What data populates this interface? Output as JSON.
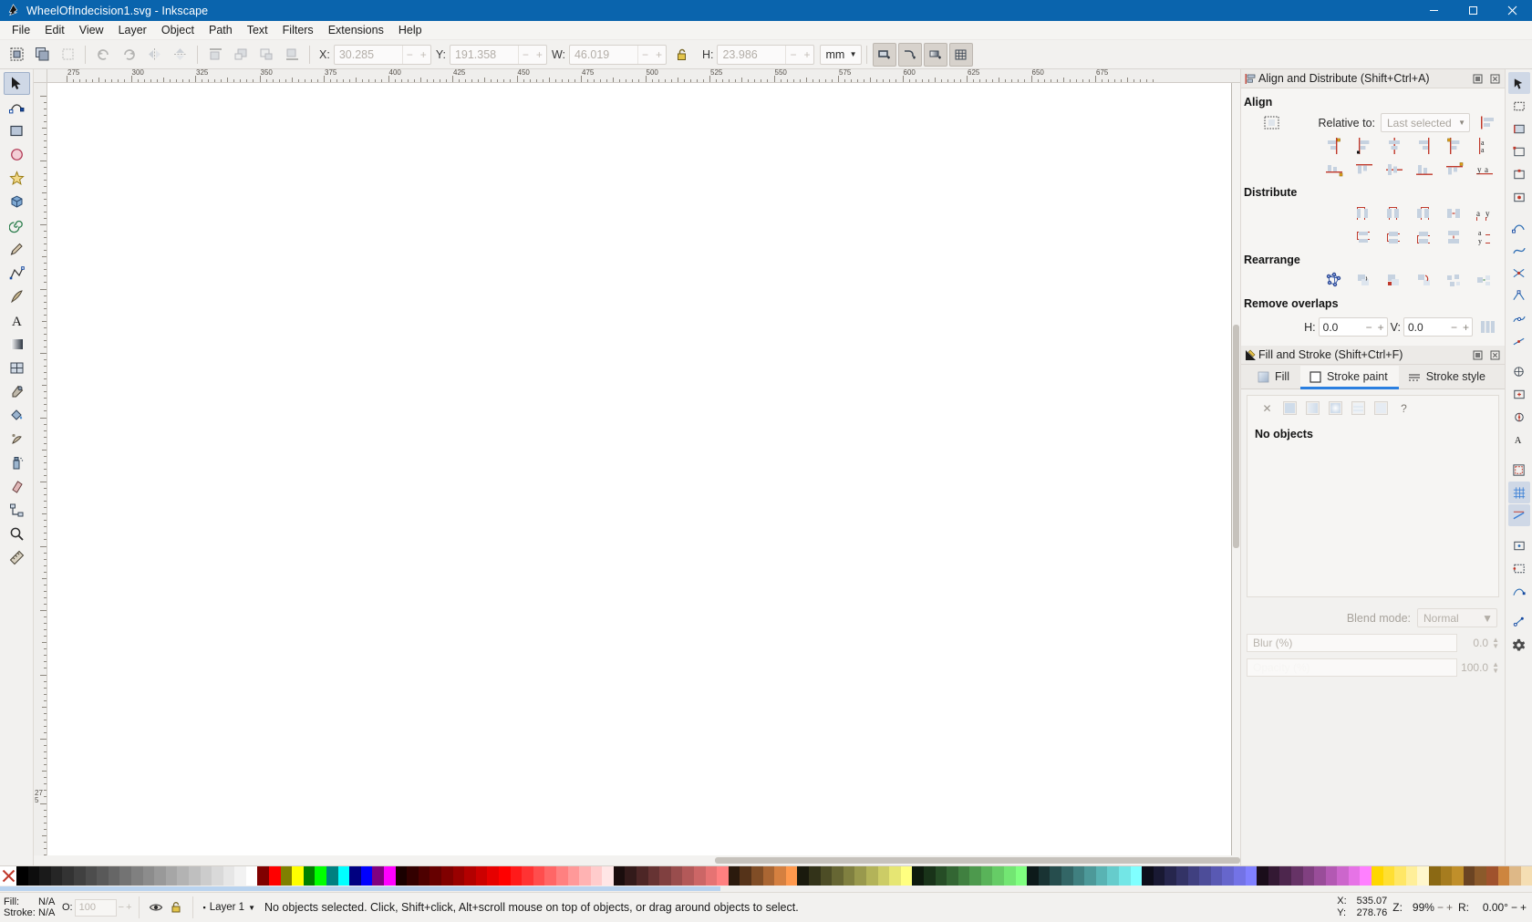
{
  "window": {
    "title": "WheelOfIndecision1.svg - Inkscape",
    "app_icon": "inkscape-logo-icon",
    "minimize": "minimize-button",
    "maximize": "maximize-button",
    "close": "close-button",
    "titlebar_color": "#0a64ad"
  },
  "menu": {
    "items": [
      "File",
      "Edit",
      "View",
      "Layer",
      "Object",
      "Path",
      "Text",
      "Filters",
      "Extensions",
      "Help"
    ]
  },
  "toolcontrols": {
    "select_all_label": "select-all-icon",
    "select_all_in_layers_label": "select-all-in-layers-icon",
    "deselect_label": "deselect-icon",
    "rotate_ccw_label": "rotate-ccw-icon",
    "rotate_cw_label": "rotate-cw-icon",
    "flip_h_label": "flip-horizontal-icon",
    "flip_v_label": "flip-vertical-icon",
    "raise_to_top_label": "raise-to-top-icon",
    "raise_label": "raise-icon",
    "lower_label": "lower-icon",
    "lower_to_bottom_label": "lower-to-bottom-icon",
    "x_label": "X:",
    "x_value": "30.285",
    "y_label": "Y:",
    "y_value": "191.358",
    "w_label": "W:",
    "w_value": "46.019",
    "lock_label": "lock-ratio-icon",
    "h_label": "H:",
    "h_value": "23.986",
    "units": "mm",
    "affect_stroke": "affect-stroke-width-icon",
    "affect_corners": "affect-rounded-corners-icon",
    "affect_gradients": "affect-gradients-icon",
    "affect_patterns": "affect-patterns-icon"
  },
  "toolbox": {
    "tools": [
      {
        "name": "selector-tool",
        "icon": "arrow-pointer",
        "active": true
      },
      {
        "name": "node-tool",
        "icon": "node-editor"
      },
      {
        "name": "rectangle-tool",
        "icon": "square"
      },
      {
        "name": "ellipse-tool",
        "icon": "circle"
      },
      {
        "name": "star-tool",
        "icon": "star"
      },
      {
        "name": "3dbox-tool",
        "icon": "cube"
      },
      {
        "name": "spiral-tool",
        "icon": "spiral"
      },
      {
        "name": "pencil-tool",
        "icon": "pencil"
      },
      {
        "name": "bezier-tool",
        "icon": "pen"
      },
      {
        "name": "calligraphy-tool",
        "icon": "calligraphy-pen"
      },
      {
        "name": "text-tool",
        "icon": "letter-a"
      },
      {
        "name": "gradient-tool",
        "icon": "gradient"
      },
      {
        "name": "mesh-tool",
        "icon": "mesh-grid"
      },
      {
        "name": "dropper-tool",
        "icon": "eyedropper"
      },
      {
        "name": "paintbucket-tool",
        "icon": "paint-bucket"
      },
      {
        "name": "tweak-tool",
        "icon": "tweak"
      },
      {
        "name": "spray-tool",
        "icon": "spray-can"
      },
      {
        "name": "eraser-tool",
        "icon": "eraser"
      },
      {
        "name": "connector-tool",
        "icon": "connector"
      },
      {
        "name": "zoom-tool",
        "icon": "magnifier"
      },
      {
        "name": "measure-tool",
        "icon": "ruler"
      }
    ]
  },
  "rulers": {
    "horizontal_labels": [
      "275",
      "300",
      "325",
      "350",
      "375",
      "400",
      "425",
      "450",
      "475",
      "500",
      "525",
      "550",
      "575",
      "600",
      "625",
      "650",
      "675"
    ],
    "vertical_labels": [
      "275"
    ]
  },
  "align_panel": {
    "title": "Align and Distribute (Shift+Ctrl+A)",
    "header_icon": "align-distribute-icon",
    "float_button": "float-panel-icon",
    "close_button": "close-panel-icon",
    "align_section": "Align",
    "treat_selection_icon": "treat-selection-as-group-icon",
    "relative_to_label": "Relative to:",
    "relative_to_value": "Last selected",
    "move_as_group_icon": "move-as-group-icon",
    "align_row1": [
      "align-right-edges-to-left-anchor-icon",
      "align-left-edges-icon",
      "center-on-vertical-axis-icon",
      "align-right-edges-icon",
      "align-left-edges-to-right-anchor-icon",
      "text-anchor-vertical-icon"
    ],
    "align_row2": [
      "align-bottom-edges-to-top-anchor-icon",
      "align-top-edges-icon",
      "center-on-horizontal-axis-icon",
      "align-bottom-edges-icon",
      "align-top-edges-to-bottom-anchor-icon",
      "text-baseline-horizontal-icon"
    ],
    "distribute_section": "Distribute",
    "distribute_row1": [
      "distribute-left-edges-icon",
      "distribute-centers-horizontally-icon",
      "distribute-right-edges-icon",
      "distribute-gaps-horizontally-icon",
      "distribute-text-anchors-horizontally-icon"
    ],
    "distribute_row2": [
      "distribute-top-edges-icon",
      "distribute-centers-vertically-icon",
      "distribute-bottom-edges-icon",
      "distribute-gaps-vertically-icon",
      "distribute-text-baselines-vertically-icon"
    ],
    "rearrange_section": "Rearrange",
    "rearrange_row": [
      "graph-layout-icon",
      "exchange-positions-selection-order-icon",
      "exchange-positions-zorder-icon",
      "exchange-positions-clockwise-icon",
      "randomize-positions-icon",
      "unclump-objects-icon"
    ],
    "remove_overlaps_section": "Remove overlaps",
    "h_label": "H:",
    "h_value": "0.0",
    "v_label": "V:",
    "v_value": "0.0",
    "remove_overlaps_button": "remove-overlaps-icon"
  },
  "fill_stroke_panel": {
    "title": "Fill and Stroke (Shift+Ctrl+F)",
    "header_icon": "fill-stroke-icon",
    "float_button": "float-panel-icon",
    "close_button": "close-panel-icon",
    "tabs": [
      {
        "label": "Fill",
        "icon": "fill-swatch-icon",
        "active": false
      },
      {
        "label": "Stroke paint",
        "icon": "stroke-swatch-icon",
        "active": true
      },
      {
        "label": "Stroke style",
        "icon": "stroke-style-icon",
        "active": false
      }
    ],
    "paint_types": [
      "no-paint-icon",
      "flat-color-icon",
      "linear-gradient-icon",
      "radial-gradient-icon",
      "pattern-icon",
      "swatch-icon",
      "unknown-paint-icon"
    ],
    "empty_message": "No objects",
    "blend_mode_label": "Blend mode:",
    "blend_mode_value": "Normal",
    "blur_label": "Blur (%)",
    "blur_value": "0.0",
    "opacity_label": "Opacity (%)",
    "opacity_value": "100.0"
  },
  "snapbar": {
    "buttons": [
      "enable-snapping-icon",
      "snap-bounding-boxes-icon",
      "snap-bbox-edges-icon",
      "snap-bbox-corners-icon",
      "snap-bbox-edge-midpoints-icon",
      "snap-bbox-centers-icon",
      "snap-nodes-paths-icon",
      "snap-paths-icon",
      "snap-path-intersections-icon",
      "snap-cusp-nodes-icon",
      "snap-smooth-nodes-icon",
      "snap-line-midpoints-icon",
      "snap-others-icon",
      "snap-object-centers-icon",
      "snap-rotation-centers-icon",
      "snap-text-baselines-icon",
      "snap-page-border-icon",
      "snap-grids-icon",
      "snap-guides-icon",
      "snap-object-midpoints-icon",
      "snap-bbox-midpoints-icon",
      "snap-object-nodes-icon",
      "snap-handles-icon",
      "snap-settings-icon"
    ]
  },
  "palette": {
    "x_button": "remove-color-icon",
    "colors": [
      "#000000",
      "#0d0d0d",
      "#1a1a1a",
      "#262626",
      "#333333",
      "#404040",
      "#4d4d4d",
      "#595959",
      "#666666",
      "#737373",
      "#808080",
      "#8c8c8c",
      "#999999",
      "#a6a6a6",
      "#b3b3b3",
      "#bfbfbf",
      "#cccccc",
      "#d9d9d9",
      "#e6e6e6",
      "#f2f2f2",
      "#ffffff",
      "#800000",
      "#ff0000",
      "#808000",
      "#ffff00",
      "#008000",
      "#00ff00",
      "#008080",
      "#00ffff",
      "#000080",
      "#0000ff",
      "#800080",
      "#ff00ff",
      "#1a0000",
      "#330000",
      "#4d0000",
      "#660000",
      "#800000",
      "#990000",
      "#b30000",
      "#cc0000",
      "#e60000",
      "#ff0000",
      "#ff1a1a",
      "#ff3333",
      "#ff4d4d",
      "#ff6666",
      "#ff8080",
      "#ff9999",
      "#ffb3b3",
      "#ffcccc",
      "#ffe6e6",
      "#1a0d0d",
      "#331a1a",
      "#4d2626",
      "#663333",
      "#804040",
      "#994d4d",
      "#b35959",
      "#cc6666",
      "#e67373",
      "#ff8080",
      "#2b1a0d",
      "#553319",
      "#804d26",
      "#aa6633",
      "#d58040",
      "#ff994d",
      "#1a1a0d",
      "#333319",
      "#4d4d26",
      "#666633",
      "#808040",
      "#99994d",
      "#b3b359",
      "#cccc66",
      "#e6e673",
      "#ffff80",
      "#0d1a0d",
      "#193319",
      "#264d26",
      "#336633",
      "#408040",
      "#4d994d",
      "#59b359",
      "#66cc66",
      "#73e673",
      "#80ff80",
      "#0d1a1a",
      "#193333",
      "#264d4d",
      "#336666",
      "#408080",
      "#4d9999",
      "#59b3b3",
      "#66cccc",
      "#73e6e6",
      "#80ffff",
      "#0d0d1a",
      "#191933",
      "#26264d",
      "#333366",
      "#404080",
      "#4d4d99",
      "#5959b3",
      "#6666cc",
      "#7373e6",
      "#8080ff",
      "#1a0d1a",
      "#331933",
      "#4d264d",
      "#663366",
      "#804080",
      "#994d99",
      "#b359b3",
      "#cc66cc",
      "#e673e6",
      "#ff80ff",
      "#ffd700",
      "#ffdf33",
      "#ffe766",
      "#ffef99",
      "#fff7cc",
      "#8b6914",
      "#a67c1f",
      "#c08f2a",
      "#6b4423",
      "#8b5a2b",
      "#a0522d",
      "#cd853f",
      "#deb887",
      "#f5deb3"
    ]
  },
  "statusbar": {
    "fill_label": "Fill:",
    "fill_value": "N/A",
    "stroke_label": "Stroke:",
    "stroke_value": "N/A",
    "opacity_label": "O:",
    "opacity_value": "100",
    "visibility_icon": "eye-icon",
    "lock_icon": "lock-icon",
    "layer_label": "Layer 1",
    "layer_indicator_icon": "layer-dot-icon",
    "layer_dropdown_icon": "chevron-down-icon",
    "message": "No objects selected. Click, Shift+click, Alt+scroll mouse on top of objects, or drag around objects to select.",
    "x_label": "X:",
    "x_value": "535.07",
    "y_label": "Y:",
    "y_value": "278.76",
    "zoom_label": "Z:",
    "zoom_value": "99%",
    "zoom_minus": "−",
    "zoom_plus": "+",
    "rotate_label": "R:",
    "rotate_value": "0.00°"
  }
}
